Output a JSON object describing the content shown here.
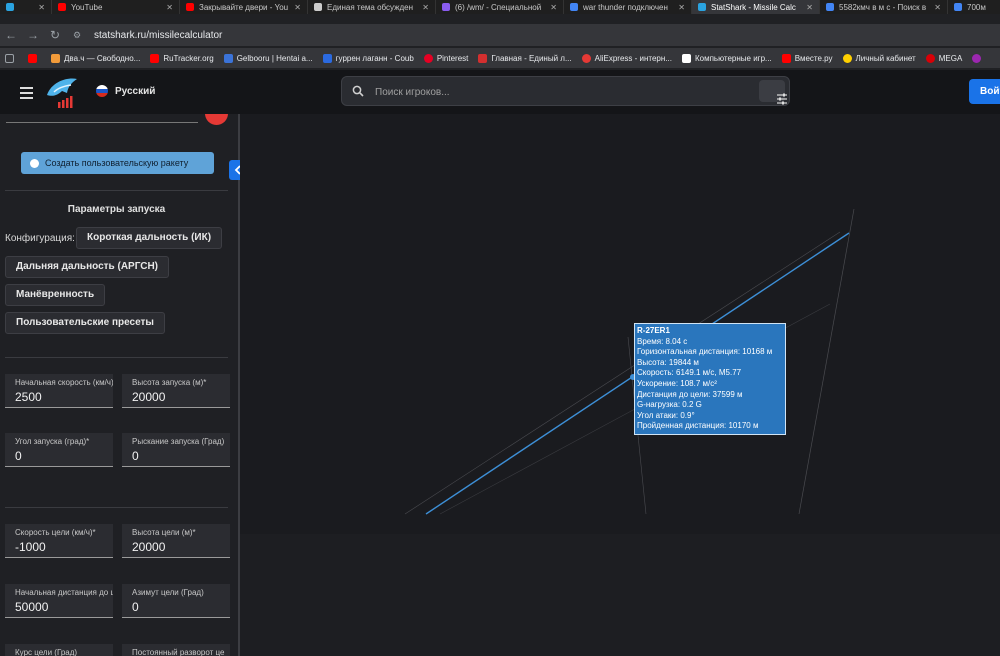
{
  "tabs": [
    {
      "label": "",
      "color": "#2aa3e0"
    },
    {
      "label": "YouTube",
      "color": "#ff0000"
    },
    {
      "label": "Закрывайте двери - You",
      "color": "#ff0000"
    },
    {
      "label": "Единая тема обсужден",
      "color": "#cccccc"
    },
    {
      "label": "(6) /wm/ - Специальной",
      "color": "#8a5cf0"
    },
    {
      "label": "war thunder подключен",
      "color": "#4285f4"
    },
    {
      "label": "StatShark - Missile Calc",
      "color": "#2aa3e0",
      "active": true
    },
    {
      "label": "5582кмч в м с - Поиск в",
      "color": "#4285f4"
    },
    {
      "label": "700м",
      "color": "#4285f4"
    }
  ],
  "browser": {
    "url": "statshark.ru/missilecalculator"
  },
  "bookmarks": [
    {
      "label": "",
      "color": "#8ab4f8"
    },
    {
      "label": "",
      "color": "#ff0000"
    },
    {
      "label": "Два.ч — Свободно...",
      "color": "#f29b3a"
    },
    {
      "label": "RuTracker.org",
      "color": "#ff0000"
    },
    {
      "label": "Gelbooru | Hentai a...",
      "color": "#3b73d8"
    },
    {
      "label": "гуррен лаганн - Coub",
      "color": "#2b6ae0"
    },
    {
      "label": "Pinterest",
      "color": "#e60023"
    },
    {
      "label": "Главная - Единый л...",
      "color": "#d32f2f"
    },
    {
      "label": "AliExpress - интерн...",
      "color": "#e53935"
    },
    {
      "label": "Компьютерные игр...",
      "color": "#ffffff"
    },
    {
      "label": "Вместе.ру",
      "color": "#ff0000"
    },
    {
      "label": "Личный кабинет",
      "color": "#ffd000"
    },
    {
      "label": "MEGA",
      "color": "#d90007"
    },
    {
      "label": "",
      "color": "#9c27b0"
    }
  ],
  "header": {
    "language": "Русский",
    "search_placeholder": "Поиск игроков...",
    "login_label": "Войт"
  },
  "sidebar": {
    "custom_missile_button": "Создать пользовательскую ракету",
    "section_title": "Параметры запуска",
    "config_label": "Конфигурация:",
    "config_options": [
      "Короткая дальность (ИК)",
      "Дальняя дальность (АРГСН)",
      "Манёвренность",
      "Пользовательские пресеты"
    ],
    "fields": {
      "launch_speed": {
        "label": "Начальная скорость (км/ч)*",
        "value": "2500"
      },
      "launch_altitude": {
        "label": "Высота запуска (м)*",
        "value": "20000"
      },
      "launch_angle": {
        "label": "Угол запуска (град)*",
        "value": "0"
      },
      "launch_yaw": {
        "label": "Рыскание запуска (Град)",
        "value": "0"
      },
      "target_speed": {
        "label": "Скорость цели (км/ч)*",
        "value": "-1000"
      },
      "target_altitude": {
        "label": "Высота цели (м)*",
        "value": "20000"
      },
      "start_distance": {
        "label": "Начальная дистанция до цели",
        "value": "50000"
      },
      "target_azimuth": {
        "label": "Азимут цели (Град)",
        "value": "0"
      },
      "target_course": {
        "label": "Курс цели (Град)",
        "value": ""
      },
      "constant_turn": {
        "label": "Постоянный разворот це",
        "value": ""
      }
    }
  },
  "tooltip": {
    "title": "R-27ER1",
    "lines": [
      "Время: 8.04 с",
      "Горизонтальная дистанция: 10168 м",
      "Высота: 19844 м",
      "Скорость: 6149.1 м/с, M5.77",
      "Ускорение: 108.7 м/с²",
      "Дистанция до цели: 37599 м",
      "G-нагрузка: 0.2 G",
      "Угол атаки: 0.9°",
      "Пройденная дистанция: 10170 м"
    ]
  },
  "colors": {
    "accent": "#1a73e8",
    "trajectory": "#3d8fd6",
    "tooltip_bg": "#2a76bd"
  }
}
